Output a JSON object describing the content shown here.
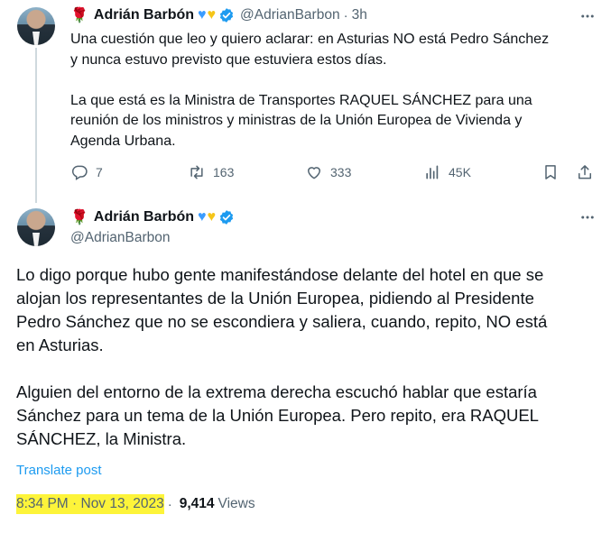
{
  "tweet1": {
    "rose": "🌹",
    "author_name": "Adrián Barbón",
    "hearts": [
      "♥",
      "♥"
    ],
    "handle": "@AdrianBarbon",
    "separator": "·",
    "time": "3h",
    "text": "Una cuestión que leo y quiero aclarar: en Asturias NO está Pedro Sánchez\ny nunca estuvo previsto que estuviera estos días.\n\nLa que está es la Ministra de Transportes RAQUEL SÁNCHEZ para una\nreunión de los ministros y ministras de la Unión Europea de Vivienda y\nAgenda Urbana.",
    "actions": {
      "replies": "7",
      "reposts": "163",
      "likes": "333",
      "views": "45K"
    }
  },
  "tweet2": {
    "rose": "🌹",
    "author_name": "Adrián Barbón",
    "hearts": [
      "♥",
      "♥"
    ],
    "handle": "@AdrianBarbon",
    "text": "Lo digo porque hubo gente manifestándose delante del hotel en que se\nalojan los representantes de la Unión Europea, pidiendo al Presidente\nPedro Sánchez que no se escondiera y saliera, cuando, repito, NO está\nen Asturias.\n\nAlguien del entorno de la extrema derecha escuchó hablar que estaría\nSánchez para un tema de la Unión Europea. Pero repito, era RAQUEL\nSÁNCHEZ, la Ministra.",
    "translate_label": "Translate post",
    "timestamp": "8:34 PM · Nov 13, 2023",
    "separator": "·",
    "views_count": "9,414",
    "views_label": "Views"
  },
  "colors": {
    "verified": "#1d9bf0",
    "link": "#1d9bf0",
    "secondary_text": "#536471",
    "highlight": "#fdf43a"
  },
  "icons": {
    "reply": "reply-icon",
    "repost": "repost-icon",
    "like": "heart-icon",
    "views": "views-icon",
    "bookmark": "bookmark-icon",
    "share": "share-icon",
    "more": "more-icon",
    "verified": "verified-badge-icon"
  }
}
